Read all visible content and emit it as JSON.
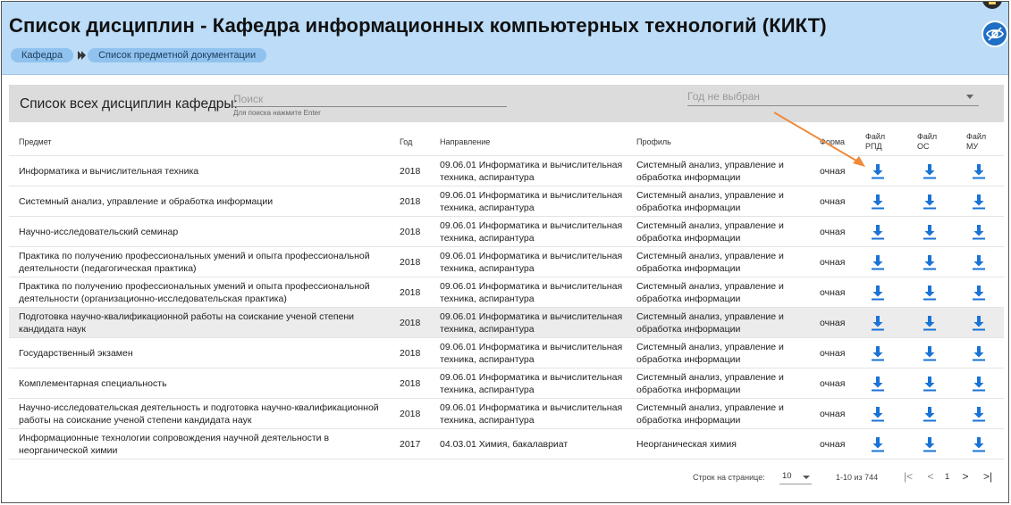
{
  "header": {
    "title": "Список дисциплин - Кафедра информационных компьютерных технологий (КИКТ)",
    "breadcrumb": [
      "Кафедра",
      "Список предметной документации"
    ]
  },
  "filter": {
    "title": "Список всех дисциплин кафедры:",
    "search_placeholder": "Поиск",
    "search_hint": "Для поиска нажмите Enter",
    "year_placeholder": "Год не выбран"
  },
  "table": {
    "columns": {
      "subject": "Предмет",
      "year": "Год",
      "direction": "Направление",
      "profile": "Профиль",
      "form": "Форма",
      "rpd": [
        "Файл",
        "РПД"
      ],
      "os": [
        "Файл",
        "ОС"
      ],
      "mu": [
        "Файл",
        "МУ"
      ]
    },
    "rows": [
      {
        "subject": "Информатика и вычислительная техника",
        "year": "2018",
        "direction": "09.06.01 Информатика и вычислительная техника, аспирантура",
        "profile": "Системный анализ, управление и обработка информации",
        "form": "очная"
      },
      {
        "subject": "Системный анализ, управление и обработка информации",
        "year": "2018",
        "direction": "09.06.01 Информатика и вычислительная техника, аспирантура",
        "profile": "Системный анализ, управление и обработка информации",
        "form": "очная"
      },
      {
        "subject": "Научно-исследовательский семинар",
        "year": "2018",
        "direction": "09.06.01 Информатика и вычислительная техника, аспирантура",
        "profile": "Системный анализ, управление и обработка информации",
        "form": "очная"
      },
      {
        "subject": "Практика по получению профессиональных умений и опыта профессиональной деятельности (педагогическая практика)",
        "year": "2018",
        "direction": "09.06.01 Информатика и вычислительная техника, аспирантура",
        "profile": "Системный анализ, управление и обработка информации",
        "form": "очная"
      },
      {
        "subject": "Практика по получению профессиональных умений и опыта профессиональной деятельности (организационно-исследовательская практика)",
        "year": "2018",
        "direction": "09.06.01 Информатика и вычислительная техника, аспирантура",
        "profile": "Системный анализ, управление и обработка информации",
        "form": "очная"
      },
      {
        "subject": "Подготовка научно-квалификационной работы на соискание ученой степени кандидата наук",
        "year": "2018",
        "direction": "09.06.01 Информатика и вычислительная техника, аспирантура",
        "profile": "Системный анализ, управление и обработка информации",
        "form": "очная",
        "highlighted": true
      },
      {
        "subject": "Государственный экзамен",
        "year": "2018",
        "direction": "09.06.01 Информатика и вычислительная техника, аспирантура",
        "profile": "Системный анализ, управление и обработка информации",
        "form": "очная"
      },
      {
        "subject": "Комплементарная специальность",
        "year": "2018",
        "direction": "09.06.01 Информатика и вычислительная техника, аспирантура",
        "profile": "Системный анализ, управление и обработка информации",
        "form": "очная"
      },
      {
        "subject": "Научно-исследовательская деятельность и подготовка научно-квалификационной работы на соискание ученой степени кандидата наук",
        "year": "2018",
        "direction": "09.06.01 Информатика и вычислительная техника, аспирантура",
        "profile": "Системный анализ, управление и обработка информации",
        "form": "очная"
      },
      {
        "subject": "Информационные технологии сопровождения научной деятельности в неорганической химии",
        "year": "2017",
        "direction": "04.03.01 Химия, бакалавриат",
        "profile": "Неорганическая химия",
        "form": "очная"
      }
    ]
  },
  "pagination": {
    "rows_per_page_label": "Строк на странице:",
    "rows_per_page": "10",
    "range": "1-10 из 744",
    "current_page": "1",
    "first_icon": "|<",
    "prev_icon": "<",
    "next_icon": ">",
    "last_icon": ">|"
  },
  "icons": {
    "download": "download-icon",
    "visibility": "eye-off-icon",
    "top_button": "notes-icon"
  },
  "colors": {
    "header_bg": "#bcdcf7",
    "crumb_bg": "#8fc2ee",
    "download_blue": "#1a73d6",
    "annotation_arrow": "#f08a3c",
    "filter_bg": "#dcdcdc"
  }
}
